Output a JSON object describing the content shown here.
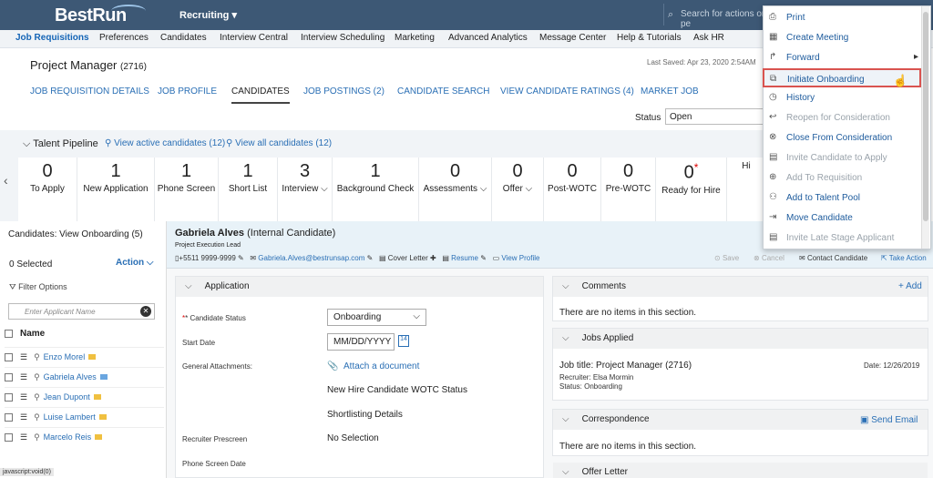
{
  "header": {
    "logo": "BestRun",
    "module": "Recruiting ▾",
    "search_placeholder": "Search for actions or pe"
  },
  "nav": {
    "items": [
      {
        "label": "Job Requisitions",
        "active": true
      },
      {
        "label": "Preferences"
      },
      {
        "label": "Candidates"
      },
      {
        "label": "Interview Central"
      },
      {
        "label": "Interview Scheduling"
      },
      {
        "label": "Marketing"
      },
      {
        "label": "Advanced Analytics"
      },
      {
        "label": "Message Center"
      },
      {
        "label": "Help & Tutorials"
      },
      {
        "label": "Ask HR"
      }
    ]
  },
  "page": {
    "title": "Project Manager",
    "req_id": "(2716)",
    "last_saved": "Last Saved: Apr 23, 2020 2:54AM"
  },
  "tabs": [
    "JOB REQUISITION DETAILS",
    "JOB PROFILE",
    "CANDIDATES",
    "JOB POSTINGS (2)",
    "CANDIDATE SEARCH",
    "VIEW CANDIDATE RATINGS (4)",
    "MARKET JOB"
  ],
  "status": {
    "label": "Status",
    "value": "Open"
  },
  "pipeline": {
    "title": "Talent Pipeline",
    "view_active": "View active candidates (12)",
    "view_all": "View all candidates (12)",
    "stages": [
      {
        "count": "0",
        "label": "To Apply"
      },
      {
        "count": "1",
        "label": "New Application"
      },
      {
        "count": "1",
        "label": "Phone Screen"
      },
      {
        "count": "1",
        "label": "Short List"
      },
      {
        "count": "3",
        "label": "Interview ⌵"
      },
      {
        "count": "1",
        "label": "Background Check"
      },
      {
        "count": "0",
        "label": "Assessments ⌵"
      },
      {
        "count": "0",
        "label": "Offer ⌵"
      },
      {
        "count": "0",
        "label": "Post-WOTC"
      },
      {
        "count": "0",
        "label": "Pre-WOTC"
      },
      {
        "count": "0*",
        "label": "Ready for Hire"
      },
      {
        "count": "",
        "label": "Hi"
      }
    ]
  },
  "left": {
    "title": "Candidates: View Onboarding (5)",
    "selected": "0 Selected",
    "action": "Action ⌵",
    "filter": "Filter Options",
    "search_placeholder": "Enter Applicant Name",
    "col_name": "Name",
    "candidates": [
      {
        "name": "Enzo Morel",
        "flag": "y"
      },
      {
        "name": "Gabriela Alves",
        "flag": "b"
      },
      {
        "name": "Jean Dupont",
        "flag": "y"
      },
      {
        "name": "Luise Lambert",
        "flag": "y"
      },
      {
        "name": "Marcelo Reis",
        "flag": "y"
      }
    ],
    "status_bar": "javascript:void(0)"
  },
  "detail": {
    "name": "Gabriela Alves",
    "type": "(Internal Candidate)",
    "role": "Project Execution Lead",
    "phone": "+5511 9999-9999",
    "email": "Gabriela.Alves@bestrunsap.com",
    "cover": "Cover Letter",
    "resume": "Resume",
    "profile": "View Profile",
    "actions": {
      "save": "Save",
      "cancel": "Cancel",
      "contact": "Contact Candidate",
      "take": "Take Action"
    }
  },
  "application": {
    "title": "Application",
    "candidate_status_label": "* Candidate Status",
    "candidate_status": "Onboarding",
    "start_date_label": "Start Date",
    "start_date_placeholder": "MM/DD/YYYY",
    "attachments_label": "General Attachments:",
    "attach": "Attach a document",
    "wotc": "New Hire Candidate WOTC Status",
    "shortlisting": "Shortlisting Details",
    "prescreen_label": "Recruiter Prescreen",
    "prescreen": "No Selection",
    "phone_screen_label": "Phone Screen Date"
  },
  "comments": {
    "title": "Comments",
    "add": "+ Add",
    "empty": "There are no items in this section."
  },
  "jobs": {
    "title": "Jobs Applied",
    "job": "Job title: Project Manager (2716)",
    "date": "Date: 12/26/2019",
    "recruiter": "Recruiter: Elsa Mormin",
    "status": "Status: Onboarding"
  },
  "corr": {
    "title": "Correspondence",
    "send": "Send Email",
    "empty": "There are no items in this section."
  },
  "offer": {
    "title": "Offer Letter"
  },
  "menu": {
    "items": [
      {
        "label": "Print",
        "icon": "print-icon",
        "glyph": "⎙",
        "disabled": false
      },
      {
        "label": "Create Meeting",
        "icon": "meeting-icon",
        "glyph": "▦",
        "disabled": false
      },
      {
        "label": "Forward",
        "icon": "forward-icon",
        "glyph": "↱",
        "disabled": false,
        "sub": "▸"
      },
      {
        "label": "Initiate Onboarding",
        "icon": "onboarding-icon",
        "glyph": "⧉",
        "disabled": false,
        "highlight": true
      },
      {
        "label": "History",
        "icon": "history-icon",
        "glyph": "◷",
        "disabled": false
      },
      {
        "label": "Reopen for Consideration",
        "icon": "reopen-icon",
        "glyph": "↩",
        "disabled": true
      },
      {
        "label": "Close From Consideration",
        "icon": "close-icon",
        "glyph": "⊗",
        "disabled": false
      },
      {
        "label": "Invite Candidate to Apply",
        "icon": "invite-icon",
        "glyph": "▤",
        "disabled": true
      },
      {
        "label": "Add To Requisition",
        "icon": "add-icon",
        "glyph": "⊕",
        "disabled": true
      },
      {
        "label": "Add to Talent Pool",
        "icon": "talent-pool-icon",
        "glyph": "⚇",
        "disabled": false
      },
      {
        "label": "Move Candidate",
        "icon": "move-icon",
        "glyph": "⇥",
        "disabled": false
      },
      {
        "label": "Invite Late Stage Applicant",
        "icon": "invite-late-icon",
        "glyph": "▤",
        "disabled": true
      }
    ]
  }
}
